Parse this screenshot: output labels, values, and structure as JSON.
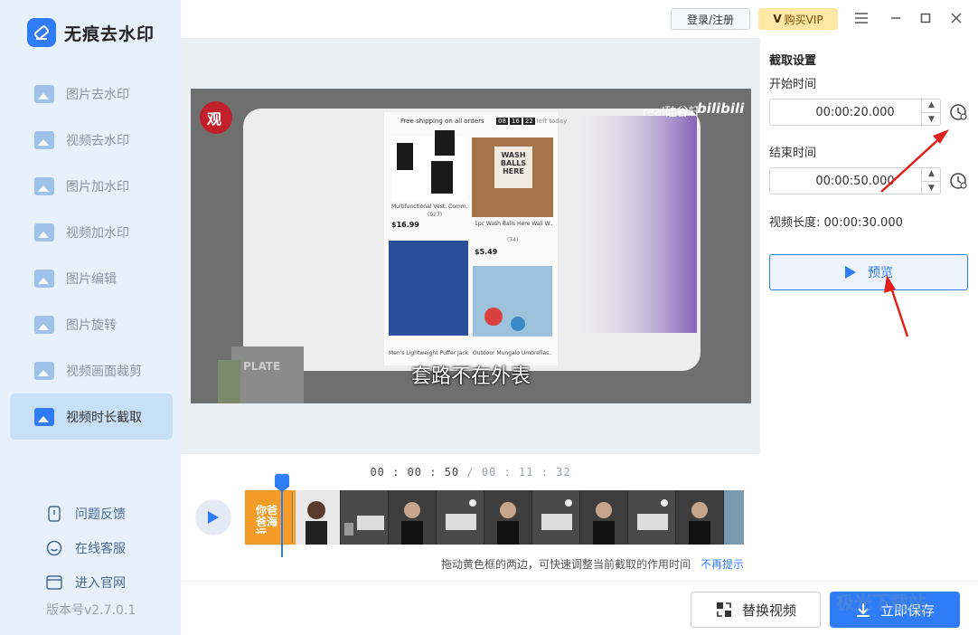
{
  "app": {
    "title": "无痕去水印",
    "version": "版本号v2.7.0.1"
  },
  "sidebar": {
    "items": [
      {
        "label": "图片去水印",
        "icon": "image-icon"
      },
      {
        "label": "视频去水印",
        "icon": "video-icon"
      },
      {
        "label": "图片加水印",
        "icon": "image-add-icon"
      },
      {
        "label": "视频加水印",
        "icon": "video-add-icon"
      },
      {
        "label": "图片编辑",
        "icon": "image-edit-icon"
      },
      {
        "label": "图片旋转",
        "icon": "image-rotate-icon"
      },
      {
        "label": "视频画面裁剪",
        "icon": "crop-icon"
      },
      {
        "label": "视频时长截取",
        "icon": "trim-icon",
        "active": true
      }
    ],
    "links": [
      {
        "label": "问题反馈",
        "icon": "feedback-icon"
      },
      {
        "label": "在线客服",
        "icon": "support-icon"
      },
      {
        "label": "进入官网",
        "icon": "website-icon"
      }
    ]
  },
  "topbar": {
    "login_label": "登录/注册",
    "vip_label": "购买VIP",
    "vip_mark": "V"
  },
  "video": {
    "subtitle": "套路不在外表",
    "shipping_text": "Free shipping on all orders",
    "countdown": [
      "08",
      "16",
      "22"
    ],
    "countdown_suffix": "left today",
    "channel": "real硅谷轩",
    "brand": "bilibili",
    "badge": "观",
    "products": [
      {
        "name": "Multifunctional Vest, Comm...",
        "price": "$16.99",
        "reviews": "(927)"
      },
      {
        "name": "1pc Wash Balls Here Wall W...",
        "price": "$5.49",
        "reviews": "(74)",
        "tag": "WASH BALLS HERE"
      },
      {
        "name": "Men's Lightweight Puffer Jack...",
        "price": ""
      },
      {
        "name": "Outdoor Mungalo Umbrellas...",
        "price": ""
      }
    ],
    "book_text": "PLATE"
  },
  "timeline": {
    "current": "00 : 00 : 50",
    "separator": " / ",
    "total": "00 : 11 : 32",
    "hint": "拖动黄色框的两边，可快速调整当前截取的作用时间",
    "hint_link": "不再提示",
    "first_frame_text": "你爸爸海运"
  },
  "panel": {
    "title": "截取设置",
    "start_label": "开始时间",
    "start_value": "00:00:20.000",
    "end_label": "结束时间",
    "end_value": "00:00:50.000",
    "duration_label": "视频长度:",
    "duration_value": "00:00:30.000",
    "preview_label": "预览"
  },
  "footer": {
    "replace_label": "替换视频",
    "save_label": "立即保存"
  },
  "watermark": "极光下载站",
  "colors": {
    "accent": "#2f7cf6",
    "sidebar_bg": "#e7f1fb",
    "selection": "#f59a23",
    "annotation": "#e0201a"
  }
}
